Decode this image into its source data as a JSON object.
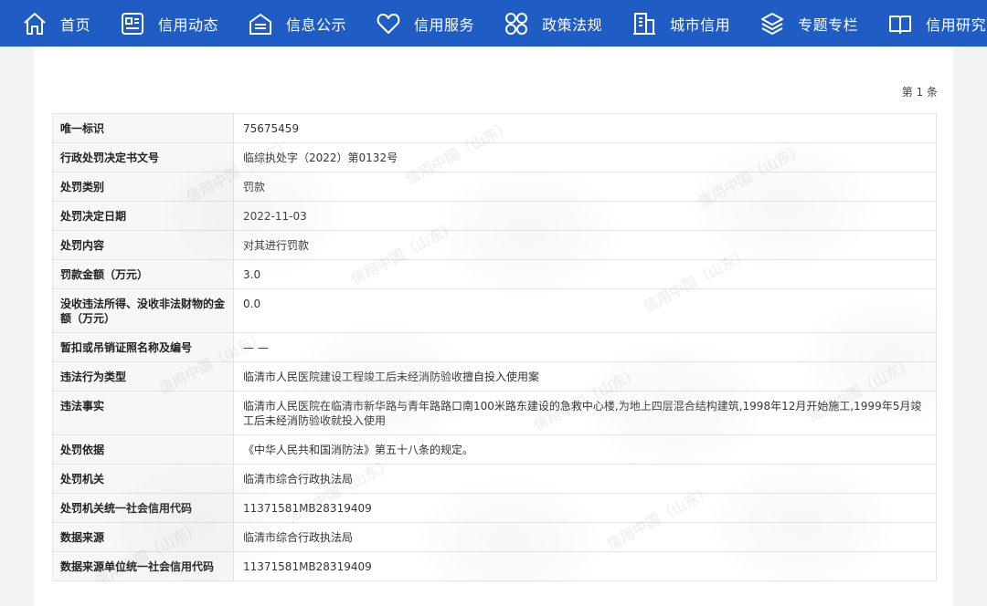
{
  "nav": {
    "items": [
      {
        "label": "首页",
        "icon": "home-icon"
      },
      {
        "label": "信用动态",
        "icon": "news-icon"
      },
      {
        "label": "信息公示",
        "icon": "document-icon"
      },
      {
        "label": "信用服务",
        "icon": "heart-icon"
      },
      {
        "label": "政策法规",
        "icon": "grid-icon"
      },
      {
        "label": "城市信用",
        "icon": "building-icon"
      },
      {
        "label": "专题专栏",
        "icon": "layers-icon"
      },
      {
        "label": "信用研究",
        "icon": "book-icon"
      }
    ],
    "bg_color": "#1f5cc4"
  },
  "page_count": "第 1 条",
  "watermark": "信用中国（山东）",
  "rows": [
    {
      "key": "唯一标识",
      "value": "75675459"
    },
    {
      "key": "行政处罚决定书文号",
      "value": "临综执处字（2022）第0132号"
    },
    {
      "key": "处罚类别",
      "value": "罚款"
    },
    {
      "key": "处罚决定日期",
      "value": "2022-11-03"
    },
    {
      "key": "处罚内容",
      "value": "对其进行罚款"
    },
    {
      "key": "罚款金额（万元）",
      "value": "3.0"
    },
    {
      "key": "没收违法所得、没收非法财物的金额（万元）",
      "value": "0.0"
    },
    {
      "key": "暂扣或吊销证照名称及编号",
      "value": "— —"
    },
    {
      "key": "违法行为类型",
      "value": "临清市人民医院建设工程竣工后未经消防验收擅自投入使用案"
    },
    {
      "key": "违法事实",
      "value": "临清市人民医院在临清市新华路与青年路路口南100米路东建设的急救中心楼,为地上四层混合结构建筑,1998年12月开始施工,1999年5月竣工后未经消防验收就投入使用"
    },
    {
      "key": "处罚依据",
      "value": "《中华人民共和国消防法》第五十八条的规定。"
    },
    {
      "key": "处罚机关",
      "value": "临清市综合行政执法局"
    },
    {
      "key": "处罚机关统一社会信用代码",
      "value": "11371581MB28319409"
    },
    {
      "key": "数据来源",
      "value": "临清市综合行政执法局"
    },
    {
      "key": "数据来源单位统一社会信用代码",
      "value": "11371581MB28319409"
    }
  ]
}
